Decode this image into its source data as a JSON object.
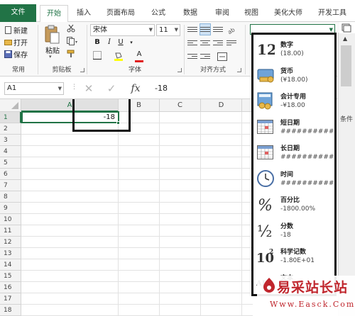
{
  "tabs": [
    {
      "label": "文件",
      "kind": "file"
    },
    {
      "label": "开始",
      "kind": "active"
    },
    {
      "label": "插入"
    },
    {
      "label": "页面布局"
    },
    {
      "label": "公式"
    },
    {
      "label": "数据"
    },
    {
      "label": "审阅"
    },
    {
      "label": "视图"
    },
    {
      "label": "美化大师"
    },
    {
      "label": "开发工具"
    }
  ],
  "ribbon": {
    "clipboard_small": {
      "new": "新建",
      "open": "打开",
      "save": "保存",
      "group": "常用"
    },
    "clipboard": {
      "paste": "粘贴",
      "group": "剪贴板"
    },
    "font": {
      "name": "宋体",
      "size": "11",
      "bold": "B",
      "italic": "I",
      "underline": "U",
      "font_color_letter": "A",
      "group": "字体"
    },
    "alignment": {
      "group": "对齐方式"
    },
    "number_format": {
      "value": ""
    }
  },
  "formula_bar": {
    "name_box": "A1",
    "fx": "fx",
    "content": "-18"
  },
  "grid": {
    "columns": [
      "A",
      "B",
      "C",
      "D"
    ],
    "rows": [
      "1",
      "2",
      "3",
      "4",
      "5",
      "6",
      "7",
      "8",
      "9",
      "10",
      "11",
      "12",
      "13",
      "14",
      "15",
      "16",
      "17",
      "18"
    ],
    "cell_a1": "-18"
  },
  "format_menu": [
    {
      "icon": "number-icon",
      "glyph": "12",
      "name": "数字",
      "sample": "(18.00)"
    },
    {
      "icon": "currency-icon",
      "name": "货币",
      "sample": "(¥18.00)"
    },
    {
      "icon": "accounting-icon",
      "name": "会计专用",
      "sample": "-¥18.00"
    },
    {
      "icon": "short-date-icon",
      "name": "短日期",
      "sample": "##########"
    },
    {
      "icon": "long-date-icon",
      "name": "长日期",
      "sample": "##########"
    },
    {
      "icon": "time-icon",
      "name": "时间",
      "sample": "##########"
    },
    {
      "icon": "percent-icon",
      "glyph": "%",
      "name": "百分比",
      "sample": "-1800.00%"
    },
    {
      "icon": "fraction-icon",
      "glyph": "½",
      "name": "分数",
      "sample": "-18"
    },
    {
      "icon": "scientific-icon",
      "glyph": "10",
      "sup": "2",
      "name": "科学记数",
      "sample": "-1.80E+01"
    },
    {
      "icon": "text-icon",
      "glyph": "ABC",
      "name": "文本",
      "sample": ""
    }
  ],
  "right_edge": {
    "label_partial": "条件"
  },
  "watermark": {
    "title": "易采站长站",
    "url": "Www.Easck.Com"
  },
  "colors": {
    "excel_green": "#217346",
    "selection_green": "#217346",
    "dropdown_border": "#111111",
    "watermark_red": "#c0262d"
  }
}
